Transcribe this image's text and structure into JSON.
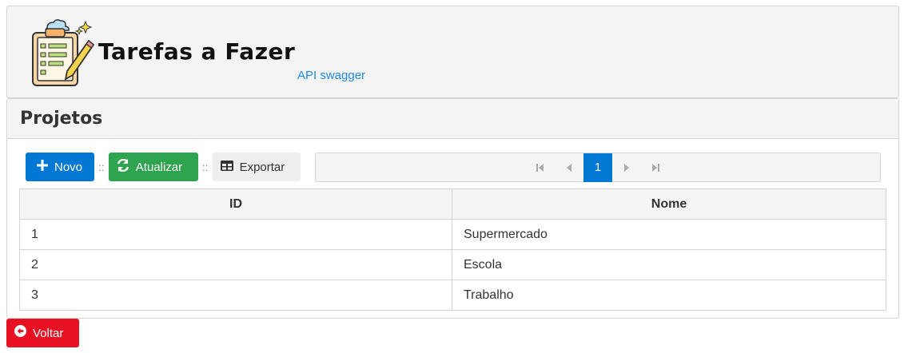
{
  "header": {
    "title": "Tarefas a Fazer",
    "api_link": "API swagger",
    "logo_icon": "clipboard-pencil-icon"
  },
  "projects": {
    "title": "Projetos",
    "toolbar": {
      "new_label": "Novo",
      "refresh_label": "Atualizar",
      "export_label": "Exportar",
      "separator": "::"
    },
    "pagination": {
      "current_page": "1"
    },
    "table": {
      "columns": [
        "ID",
        "Nome"
      ],
      "rows": [
        {
          "id": "1",
          "name": "Supermercado"
        },
        {
          "id": "2",
          "name": "Escola"
        },
        {
          "id": "3",
          "name": "Trabalho"
        }
      ]
    }
  },
  "footer": {
    "back_label": "Voltar"
  },
  "colors": {
    "primary": "#0078d4",
    "success": "#2ea44f",
    "danger": "#e81123",
    "link": "#1e88e5"
  }
}
